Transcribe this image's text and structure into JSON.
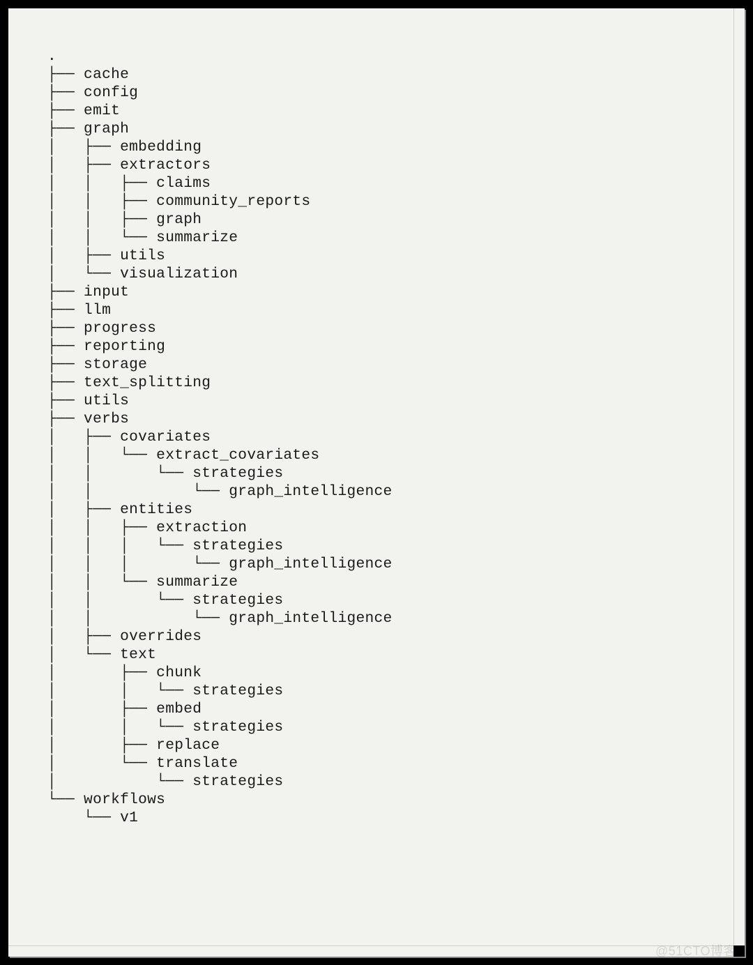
{
  "watermark": "@51CTO博客",
  "tree": {
    "root": ".",
    "lines": [
      "├── cache",
      "├── config",
      "├── emit",
      "├── graph",
      "│   ├── embedding",
      "│   ├── extractors",
      "│   │   ├── claims",
      "│   │   ├── community_reports",
      "│   │   ├── graph",
      "│   │   └── summarize",
      "│   ├── utils",
      "│   └── visualization",
      "├── input",
      "├── llm",
      "├── progress",
      "├── reporting",
      "├── storage",
      "├── text_splitting",
      "├── utils",
      "├── verbs",
      "│   ├── covariates",
      "│   │   └── extract_covariates",
      "│   │       └── strategies",
      "│   │           └── graph_intelligence",
      "│   ├── entities",
      "│   │   ├── extraction",
      "│   │   │   └── strategies",
      "│   │   │       └── graph_intelligence",
      "│   │   └── summarize",
      "│   │       └── strategies",
      "│   │           └── graph_intelligence",
      "│   ├── overrides",
      "│   └── text",
      "│       ├── chunk",
      "│       │   └── strategies",
      "│       ├── embed",
      "│       │   └── strategies",
      "│       ├── replace",
      "│       └── translate",
      "│           └── strategies",
      "└── workflows",
      "    └── v1"
    ]
  }
}
